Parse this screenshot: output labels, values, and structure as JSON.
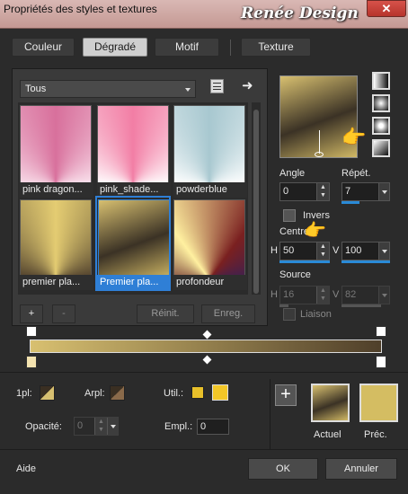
{
  "window": {
    "title": "Propriétés des styles et textures",
    "watermark": "Renée Design",
    "close_glyph": "✕"
  },
  "tabs": [
    {
      "label": "Couleur",
      "active": false
    },
    {
      "label": "Dégradé",
      "active": true
    },
    {
      "label": "Motif",
      "active": false
    },
    {
      "label": "Texture",
      "active": false
    }
  ],
  "category": {
    "value": "Tous"
  },
  "gradients": [
    {
      "label": "pink dragon...",
      "bg": "conic-gradient(from 180deg at 50% 100%,#e890b8,#f8dce8,#d8709c,#fae4ee,#e890b8)"
    },
    {
      "label": "pink_shade...",
      "bg": "conic-gradient(from 180deg at 50% 100%,#f6b9cc,#ffffff,#f27ea5,#ffffff,#f6b9cc)"
    },
    {
      "label": "powderblue",
      "bg": "conic-gradient(from 180deg at 50% 100%,#c8dfe4,#ffffff,#a8c8d0,#ffffff,#c8dfe4)"
    },
    {
      "label": "premier pla...",
      "bg": "conic-gradient(from 180deg at 50% 100%,#d8c26c,#4a3b2a,#e4cc72,#4a3b2a,#d8c26c)"
    },
    {
      "label": "Premier pla...",
      "bg": "linear-gradient(160deg,#d8c070 0%,#3b3225 55%,#d0b865 100%)",
      "selected": true
    },
    {
      "label": "profondeur",
      "bg": "conic-gradient(from 180deg at 50% 100%,#f0a030,#5a1a20,#fff0a0,#7a2020,#2a2060,#f0a030)"
    }
  ],
  "list_buttons": {
    "add": "+",
    "remove": "-",
    "reset": "Réinit.",
    "save": "Enreg."
  },
  "angle": {
    "label": "Angle",
    "value": "0"
  },
  "repeat": {
    "label": "Répét.",
    "value": "7"
  },
  "invert": {
    "label": "Invers",
    "checked": false
  },
  "center": {
    "label": "Centre",
    "h_label": "H",
    "h": "50",
    "v_label": "V",
    "v": "100"
  },
  "source": {
    "label": "Source",
    "h_label": "H",
    "h": "16",
    "v_label": "V",
    "v": "82"
  },
  "link": {
    "label": "Liaison",
    "checked": false
  },
  "gradient_bar": {
    "start": "#d8c070",
    "end": "#4f3f2a"
  },
  "stops": {
    "first_label": "1pl:",
    "back_label": "Arpl:",
    "util_label": "Util.:",
    "opacity_label": "Opacité:",
    "opacity_value": "0",
    "location_label": "Empl.:",
    "location_value": "0",
    "util_color_1": "#e8c02a",
    "util_color_2": "#f2c627"
  },
  "preview": {
    "current_label": "Actuel",
    "previous_label": "Préc.",
    "previous_color": "#d4bd62"
  },
  "footer": {
    "help": "Aide",
    "ok": "OK",
    "cancel": "Annuler"
  },
  "colors": {
    "accent": "#2a8ad6"
  }
}
